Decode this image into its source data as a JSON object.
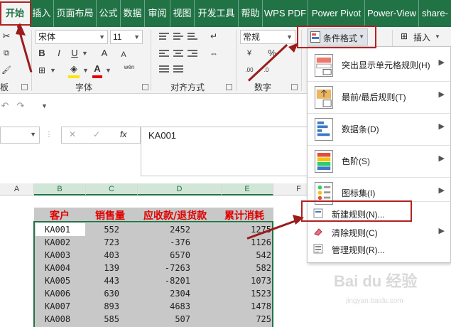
{
  "tabs": [
    "开始",
    "插入",
    "页面布局",
    "公式",
    "数据",
    "审阅",
    "视图",
    "开发工具",
    "帮助",
    "WPS PDF",
    "Power Pivot",
    "Power-View",
    "share-"
  ],
  "ribbon": {
    "font_name": "宋体",
    "font_size": "11",
    "bold": "B",
    "italic": "I",
    "underline": "U",
    "grow_font": "A",
    "shrink_font": "A",
    "font_color_letter": "A",
    "pinyin": "wén",
    "number_format": "常规",
    "percent": "%",
    "font_group_label": "字体",
    "align_group_label": "对齐方式",
    "number_group_label": "数字",
    "cond_format_label": "条件格式",
    "insert_label": "插入",
    "clip_label": "板"
  },
  "formula_bar": {
    "fx": "fx",
    "cancel": "✕",
    "confirm": "✓",
    "value": "KA001"
  },
  "columns": [
    "A",
    "B",
    "C",
    "D",
    "E",
    "F"
  ],
  "table": {
    "headers": [
      "客户",
      "销售量",
      "应收款/退货款",
      "累计消耗"
    ],
    "rows": [
      {
        "c": "KA001",
        "q": "552",
        "r": "2452",
        "t": "1275"
      },
      {
        "c": "KA002",
        "q": "723",
        "r": "-376",
        "t": "1126"
      },
      {
        "c": "KA003",
        "q": "403",
        "r": "6570",
        "t": "542"
      },
      {
        "c": "KA004",
        "q": "139",
        "r": "-7263",
        "t": "582"
      },
      {
        "c": "KA005",
        "q": "443",
        "r": "-8201",
        "t": "1073"
      },
      {
        "c": "KA006",
        "q": "630",
        "r": "2304",
        "t": "1523"
      },
      {
        "c": "KA007",
        "q": "893",
        "r": "4683",
        "t": "1478"
      },
      {
        "c": "KA008",
        "q": "585",
        "r": "507",
        "t": "725"
      }
    ]
  },
  "menu": {
    "big_items": [
      "突出显示单元格规则(H)",
      "最前/最后规则(T)",
      "数据条(D)",
      "色阶(S)",
      "图标集(I)"
    ],
    "small_items": [
      "新建规则(N)...",
      "清除规则(C)",
      "管理规则(R)..."
    ],
    "submenu_arrow": "▶"
  },
  "watermark": "Bai du 经验",
  "watermark_url": "jingyan.baidu.com",
  "colors": {
    "excel_green": "#217346",
    "header_red": "#e00000",
    "annotation_red": "#b22222"
  }
}
